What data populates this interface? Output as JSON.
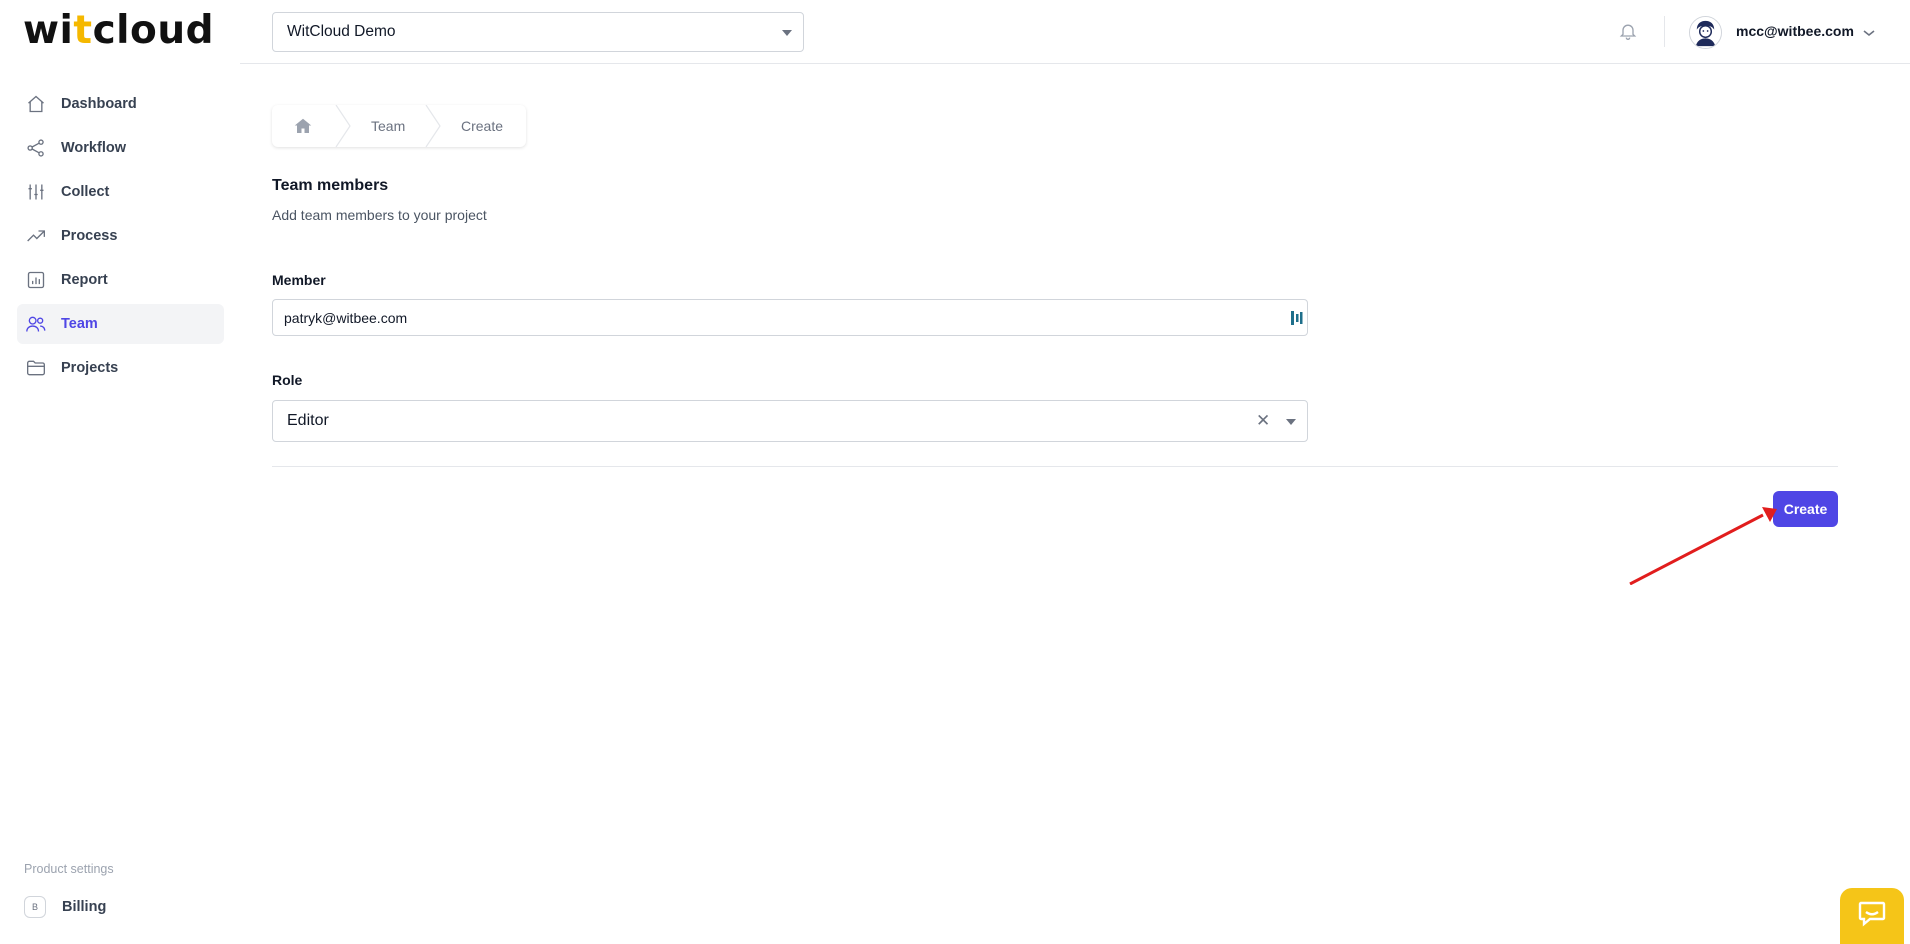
{
  "app": {
    "logo_parts": [
      "wi",
      "t",
      "cloud"
    ]
  },
  "header": {
    "project_selected": "WitCloud Demo",
    "user_email": "mcc@witbee.com"
  },
  "sidebar": {
    "items": [
      {
        "label": "Dashboard",
        "icon": "home-icon"
      },
      {
        "label": "Workflow",
        "icon": "share-icon"
      },
      {
        "label": "Collect",
        "icon": "sliders-icon"
      },
      {
        "label": "Process",
        "icon": "trending-up-icon"
      },
      {
        "label": "Report",
        "icon": "bar-chart-icon"
      },
      {
        "label": "Team",
        "icon": "users-icon",
        "active": true
      },
      {
        "label": "Projects",
        "icon": "folder-icon"
      }
    ],
    "settings_title": "Product settings",
    "billing": {
      "badge": "B",
      "label": "Billing"
    }
  },
  "breadcrumb": {
    "items": [
      "Team",
      "Create"
    ]
  },
  "form": {
    "title": "Team members",
    "subtitle": "Add team members to your project",
    "member_label": "Member",
    "member_value": "patryk@witbee.com",
    "role_label": "Role",
    "role_value": "Editor",
    "clear_symbol": "✕",
    "submit_label": "Create"
  },
  "colors": {
    "accent": "#4f46e5",
    "brand_yellow": "#f5c518",
    "annotation_arrow": "#e11d1d"
  }
}
